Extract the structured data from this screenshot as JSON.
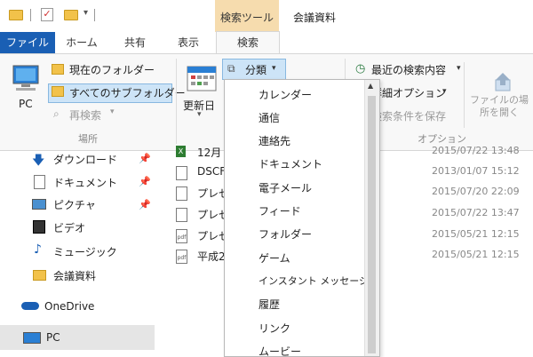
{
  "window": {
    "title": "会議資料",
    "context_group": "検索ツール"
  },
  "tabs": [
    {
      "label": "ファイル"
    },
    {
      "label": "ホーム"
    },
    {
      "label": "共有"
    },
    {
      "label": "表示"
    },
    {
      "label": "検索"
    }
  ],
  "ribbon": {
    "location": {
      "pc": "PC",
      "current_folder": "現在のフォルダー",
      "all_subfolders": "すべてのサブフォルダー",
      "search_again": "再検索",
      "group_label": "場所"
    },
    "refine": {
      "date_modified": "更新日",
      "kind": "分類"
    },
    "options": {
      "recent_searches": "最近の検索内容",
      "advanced": "詳細オプション",
      "save_search": "検索条件を保存",
      "open_location": "ファイルの場所を開く",
      "group_label": "オプション"
    }
  },
  "nav": [
    {
      "label": "ダウンロード",
      "icon": "download-icon",
      "pinned": true
    },
    {
      "label": "ドキュメント",
      "icon": "documents-icon",
      "pinned": true
    },
    {
      "label": "ピクチャ",
      "icon": "pictures-icon",
      "pinned": true
    },
    {
      "label": "ビデオ",
      "icon": "video-icon",
      "pinned": false
    },
    {
      "label": "ミュージック",
      "icon": "music-icon",
      "pinned": false
    },
    {
      "label": "会議資料",
      "icon": "folder-icon",
      "pinned": false
    },
    {
      "label": "OneDrive",
      "icon": "onedrive-icon",
      "pinned": false
    },
    {
      "label": "PC",
      "icon": "pc-icon",
      "pinned": false
    }
  ],
  "files": [
    {
      "name": "12月",
      "date": "2015/07/22 13:48",
      "icon": "excel-icon"
    },
    {
      "name": "DSCF",
      "date": "2013/01/07 15:12",
      "icon": "image-icon"
    },
    {
      "name": "プレゼ",
      "date": "2015/07/20 22:09",
      "icon": "document-icon"
    },
    {
      "name": "プレゼ",
      "date": "2015/07/22 13:47",
      "icon": "document-icon"
    },
    {
      "name": "プレゼ",
      "date": "2015/05/21 12:15",
      "icon": "pdf-icon"
    },
    {
      "name": "平成2",
      "date": "2015/05/21 12:15",
      "icon": "pdf-icon"
    }
  ],
  "kind_menu": [
    "カレンダー",
    "通信",
    "連絡先",
    "ドキュメント",
    "電子メール",
    "フィード",
    "フォルダー",
    "ゲーム",
    "インスタント メッセージ",
    "履歴",
    "リンク",
    "ムービー"
  ],
  "colors": {
    "accent": "#1a5fb4",
    "context_tab": "#f6dcae",
    "selection": "#cde4f7"
  }
}
